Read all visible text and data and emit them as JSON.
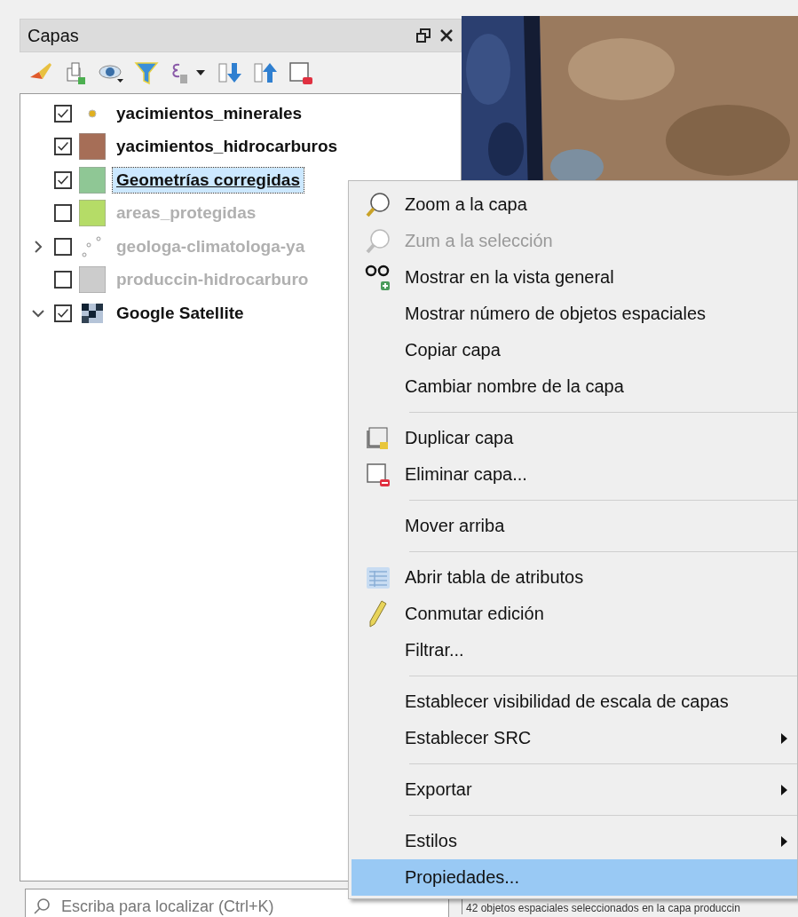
{
  "panel": {
    "title": "Capas"
  },
  "layers": [
    {
      "name": "yacimientos_minerales",
      "checked": true,
      "selected": false,
      "kind": "point",
      "color": "#e0b020"
    },
    {
      "name": "yacimientos_hidrocarburos",
      "checked": true,
      "selected": false,
      "kind": "fill",
      "color": "#a66e57"
    },
    {
      "name": "Geometrías corregidas",
      "checked": true,
      "selected": true,
      "kind": "fill",
      "color": "#8fc795"
    },
    {
      "name": "areas_protegidas",
      "checked": false,
      "selected": false,
      "kind": "fill",
      "color": "#b5dc67"
    },
    {
      "name": "geologa-climatologa-ya",
      "checked": false,
      "selected": false,
      "kind": "points",
      "expanded": false
    },
    {
      "name": "produccin-hidrocarburo",
      "checked": false,
      "selected": false,
      "kind": "fill",
      "color": "#cccccc"
    },
    {
      "name": "Google Satellite",
      "checked": true,
      "selected": false,
      "kind": "raster",
      "expanded": true
    }
  ],
  "search": {
    "placeholder": "Escriba para localizar (Ctrl+K)"
  },
  "status_bar": {
    "text": "42 objetos espaciales seleccionados en la capa produccin"
  },
  "context_menu": [
    {
      "kind": "zoom",
      "label": "Zoom a la capa",
      "disabled": false,
      "submenu": false,
      "selected": false
    },
    {
      "kind": "zoom",
      "label": "Zum a la selección",
      "disabled": true,
      "submenu": false,
      "selected": false
    },
    {
      "kind": "overview",
      "label": "Mostrar en la vista general",
      "disabled": false,
      "submenu": false,
      "selected": false
    },
    {
      "kind": "plain",
      "label": "Mostrar número de objetos espaciales",
      "disabled": false,
      "submenu": false,
      "selected": false
    },
    {
      "kind": "plain",
      "label": "Copiar capa",
      "disabled": false,
      "submenu": false,
      "selected": false
    },
    {
      "kind": "plain",
      "label": "Cambiar nombre de la capa",
      "disabled": false,
      "submenu": false,
      "selected": false
    },
    {
      "kind": "separator"
    },
    {
      "kind": "duplicate",
      "label": "Duplicar capa",
      "disabled": false,
      "submenu": false,
      "selected": false
    },
    {
      "kind": "remove",
      "label": "Eliminar capa...",
      "disabled": false,
      "submenu": false,
      "selected": false
    },
    {
      "kind": "separator"
    },
    {
      "kind": "plain",
      "label": "Mover arriba",
      "disabled": false,
      "submenu": false,
      "selected": false
    },
    {
      "kind": "separator"
    },
    {
      "kind": "table",
      "label": "Abrir tabla de atributos",
      "disabled": false,
      "submenu": false,
      "selected": false
    },
    {
      "kind": "pencil",
      "label": "Conmutar edición",
      "disabled": false,
      "submenu": false,
      "selected": false
    },
    {
      "kind": "plain",
      "label": "Filtrar...",
      "disabled": false,
      "submenu": false,
      "selected": false
    },
    {
      "kind": "separator"
    },
    {
      "kind": "plain",
      "label": "Establecer visibilidad de escala de capas",
      "disabled": false,
      "submenu": false,
      "selected": false
    },
    {
      "kind": "plain",
      "label": "Establecer SRC",
      "disabled": false,
      "submenu": true,
      "selected": false
    },
    {
      "kind": "separator"
    },
    {
      "kind": "plain",
      "label": "Exportar",
      "disabled": false,
      "submenu": true,
      "selected": false
    },
    {
      "kind": "separator"
    },
    {
      "kind": "plain",
      "label": "Estilos",
      "disabled": false,
      "submenu": true,
      "selected": false
    },
    {
      "kind": "plain",
      "label": "Propiedades...",
      "disabled": false,
      "submenu": false,
      "selected": true
    }
  ]
}
